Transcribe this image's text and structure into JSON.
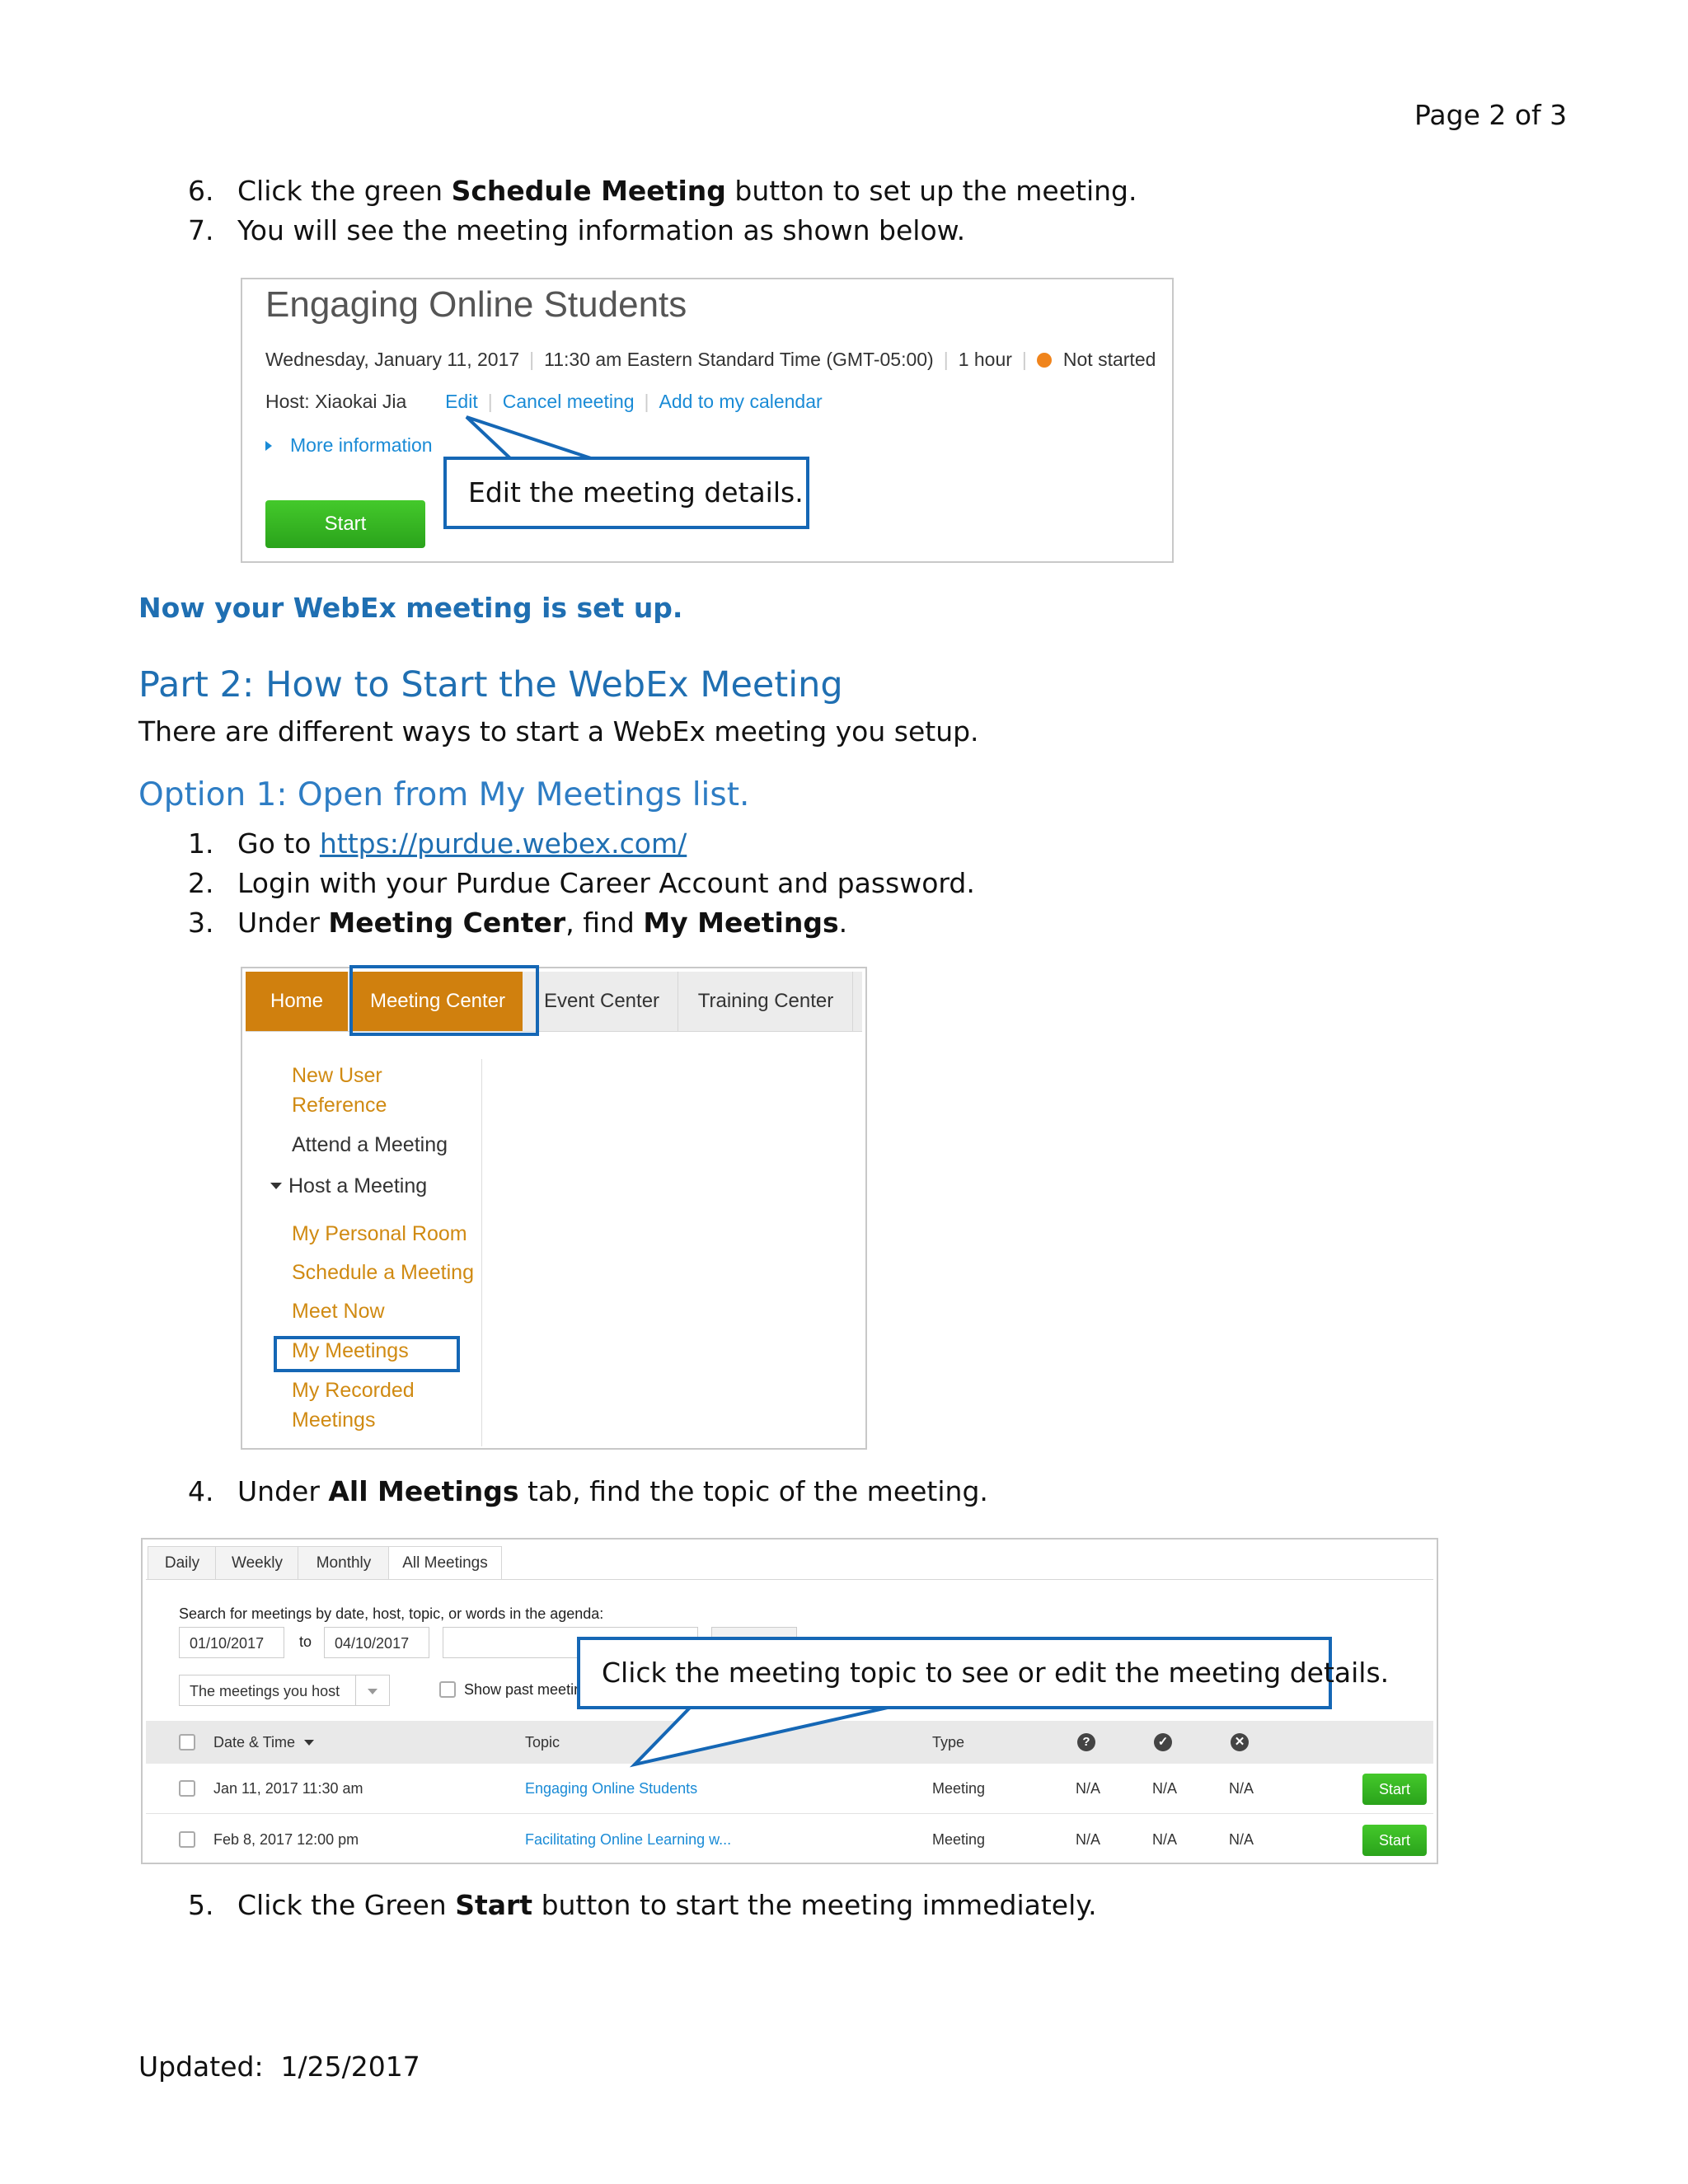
{
  "page_header": "Page 2 of 3",
  "steps_a": [
    {
      "num": "6.",
      "pre": "Click the green ",
      "bold": "Schedule Meeting",
      "post": " button to set up the meeting."
    },
    {
      "num": "7.",
      "pre": "You will see the meeting information as shown below.",
      "bold": "",
      "post": ""
    }
  ],
  "meeting_card": {
    "title": "Engaging Online Students",
    "date": "Wednesday, January 11, 2017",
    "time": "11:30 am Eastern Standard Time (GMT-05:00)",
    "duration": "1 hour",
    "status": "Not started",
    "status_color": "#f0841c",
    "host": "Host: Xiaokai Jia",
    "edit": "Edit",
    "cancel": "Cancel meeting",
    "add_calendar": "Add to my calendar",
    "more_info": "More information",
    "start": "Start",
    "callout": "Edit the meeting details."
  },
  "setup_done": "Now your WebEx meeting is set up.",
  "part2_title": "Part 2: How to Start the WebEx Meeting",
  "part2_intro": "There are different ways to start a WebEx meeting you setup.",
  "option1_title": "Option 1: Open from My Meetings list.",
  "steps_b": {
    "s1_num": "1.",
    "s1_pre": "Go to ",
    "s1_link": "https://purdue.webex.com/",
    "s2_num": "2.",
    "s2_text": "Login with your Purdue Career Account and password.",
    "s3_num": "3.",
    "s3_pre": "Under ",
    "s3_b1": "Meeting Center",
    "s3_mid": ", find ",
    "s3_b2": "My Meetings",
    "s3_post": "."
  },
  "nav": {
    "tabs": [
      "Home",
      "Meeting Center",
      "Event Center",
      "Training Center"
    ],
    "menu": {
      "new_user_1": "New User",
      "new_user_2": "Reference",
      "attend": "Attend a Meeting",
      "host": "Host a Meeting",
      "personal_room": "My Personal Room",
      "schedule": "Schedule a Meeting",
      "meet_now": "Meet Now",
      "my_meetings": "My Meetings",
      "recorded_1": "My Recorded",
      "recorded_2": "Meetings"
    }
  },
  "step4": {
    "num": "4.",
    "pre": "Under ",
    "bold": "All Meetings",
    "post": " tab, find the topic of the meeting."
  },
  "meetings_list": {
    "tabs": [
      "Daily",
      "Weekly",
      "Monthly",
      "All Meetings"
    ],
    "search_label": "Search for meetings by date, host, topic, or words in the agenda:",
    "date_from": "01/10/2017",
    "to": "to",
    "date_to": "04/10/2017",
    "filter": "The meetings you host",
    "show_past": "Show past meetir",
    "callout": "Click the meeting topic to see or edit the meeting details.",
    "headers": {
      "date": "Date & Time",
      "topic": "Topic",
      "type": "Type"
    },
    "rows": [
      {
        "date": "Jan 11, 2017 11:30 am",
        "topic": "Engaging Online Students",
        "type": "Meeting",
        "a": "N/A",
        "b": "N/A",
        "c": "N/A",
        "btn": "Start"
      },
      {
        "date": "Feb 8, 2017 12:00 pm",
        "topic": "Facilitating Online Learning w...",
        "type": "Meeting",
        "a": "N/A",
        "b": "N/A",
        "c": "N/A",
        "btn": "Start"
      }
    ]
  },
  "step5": {
    "num": "5.",
    "pre": "Click the Green ",
    "bold": "Start",
    "post": " button to start the meeting immediately."
  },
  "footer": "Updated:  1/25/2017"
}
